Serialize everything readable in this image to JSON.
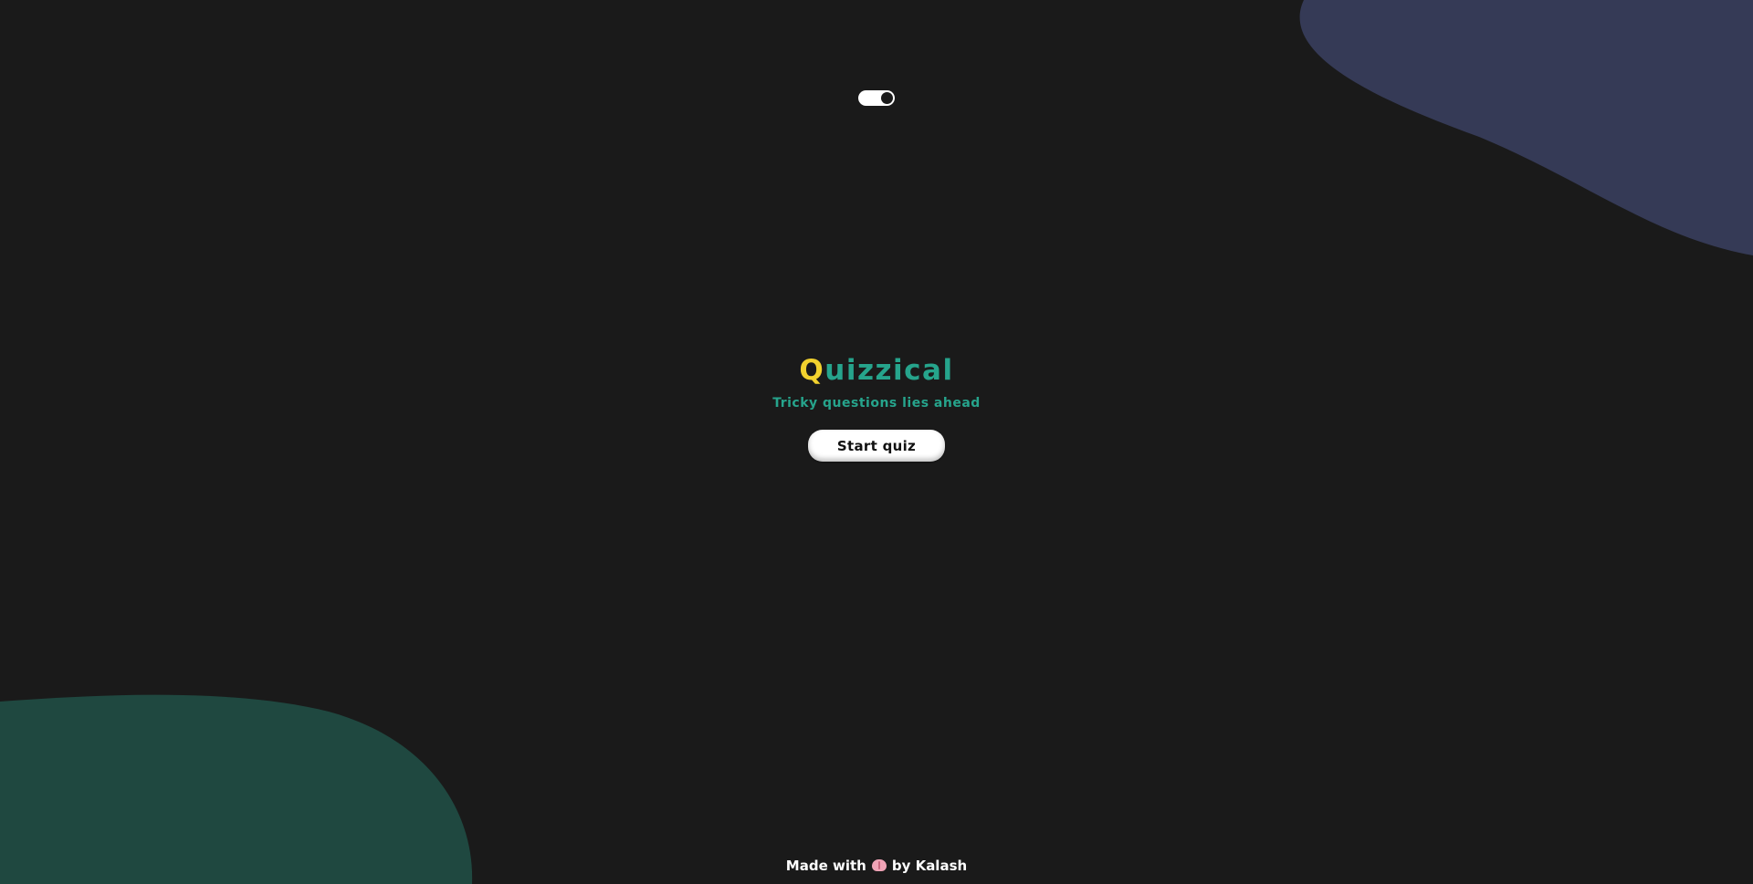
{
  "app": {
    "title_first_letter": "Q",
    "title_rest": "uizzical",
    "subtitle": "Tricky questions lies ahead"
  },
  "actions": {
    "start_label": "Start quiz"
  },
  "theme_toggle": {
    "state": "dark"
  },
  "footer": {
    "prefix": "Made with",
    "icon": "brain-icon",
    "suffix": "by Kalash"
  },
  "colors": {
    "background": "#1a1a1a",
    "title_accent": "#f2d22e",
    "title_primary": "#26a48c",
    "blob_top_right": "#353a56",
    "blob_bottom_left": "#1f4840",
    "button_bg": "#ffffff"
  }
}
